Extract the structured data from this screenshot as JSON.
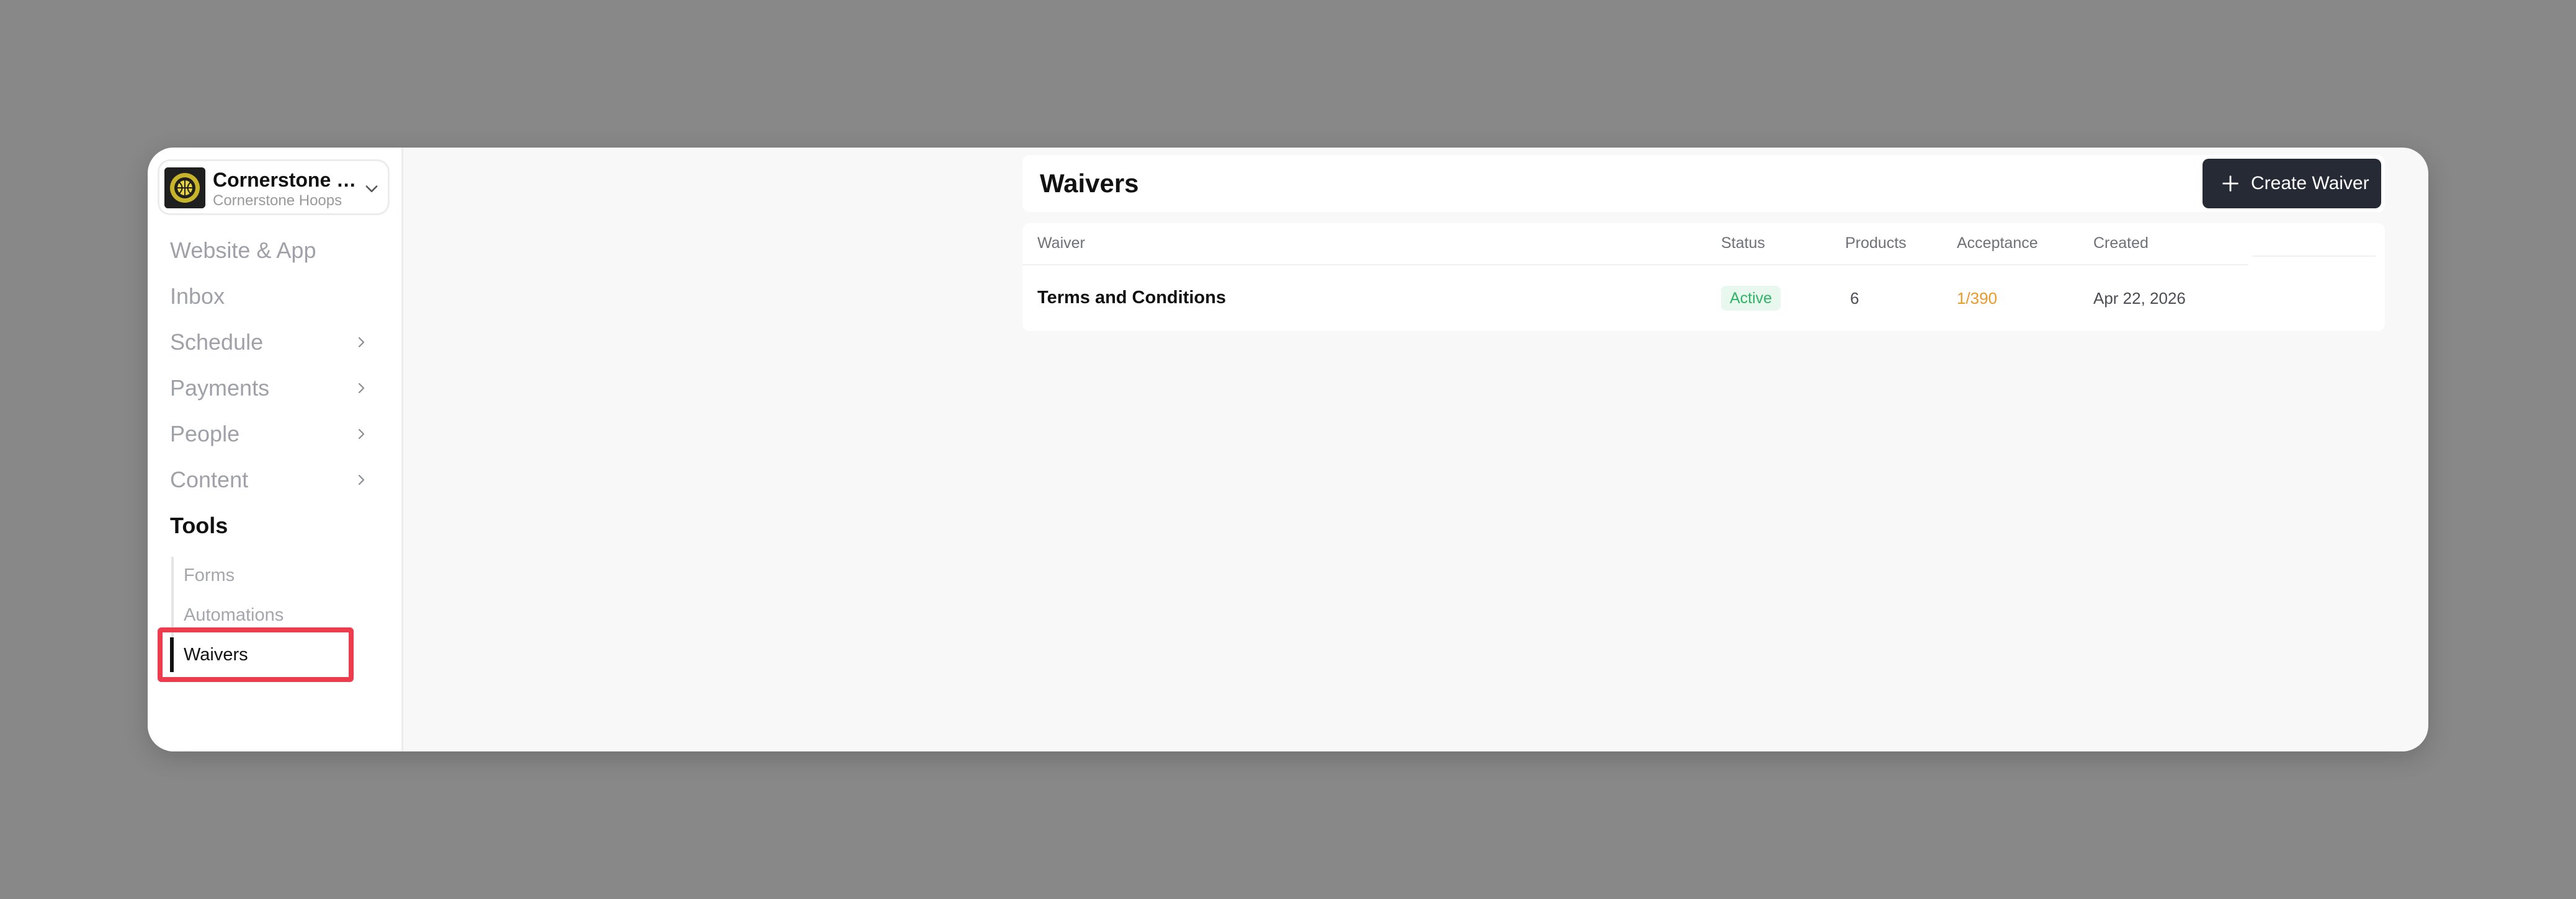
{
  "org": {
    "name": "Cornerstone H...",
    "subtitle": "Cornerstone Hoops",
    "logo_icon": "basketball-crest-icon"
  },
  "sidebar": {
    "items": [
      {
        "label": "Website & App",
        "has_chevron": false
      },
      {
        "label": "Inbox",
        "has_chevron": false
      },
      {
        "label": "Schedule",
        "has_chevron": true
      },
      {
        "label": "Payments",
        "has_chevron": true
      },
      {
        "label": "People",
        "has_chevron": true
      },
      {
        "label": "Content",
        "has_chevron": true
      },
      {
        "label": "Tools",
        "has_chevron": false,
        "active": true
      }
    ],
    "subitems": [
      {
        "label": "Forms"
      },
      {
        "label": "Automations"
      },
      {
        "label": "Waivers",
        "active": true
      }
    ]
  },
  "header": {
    "title": "Waivers",
    "create_button_label": "Create Waiver"
  },
  "table": {
    "columns": [
      "Waiver",
      "Status",
      "Products",
      "Acceptance",
      "Created"
    ],
    "rows": [
      {
        "waiver": "Terms and Conditions",
        "status": "Active",
        "products": "6",
        "acceptance": "1/390",
        "created": "Apr 22, 2026"
      }
    ]
  },
  "colors": {
    "accent_button": "#262a35",
    "status_active": "#2fb365",
    "acceptance": "#eb9a2a",
    "highlight": "#ef3b4e"
  }
}
